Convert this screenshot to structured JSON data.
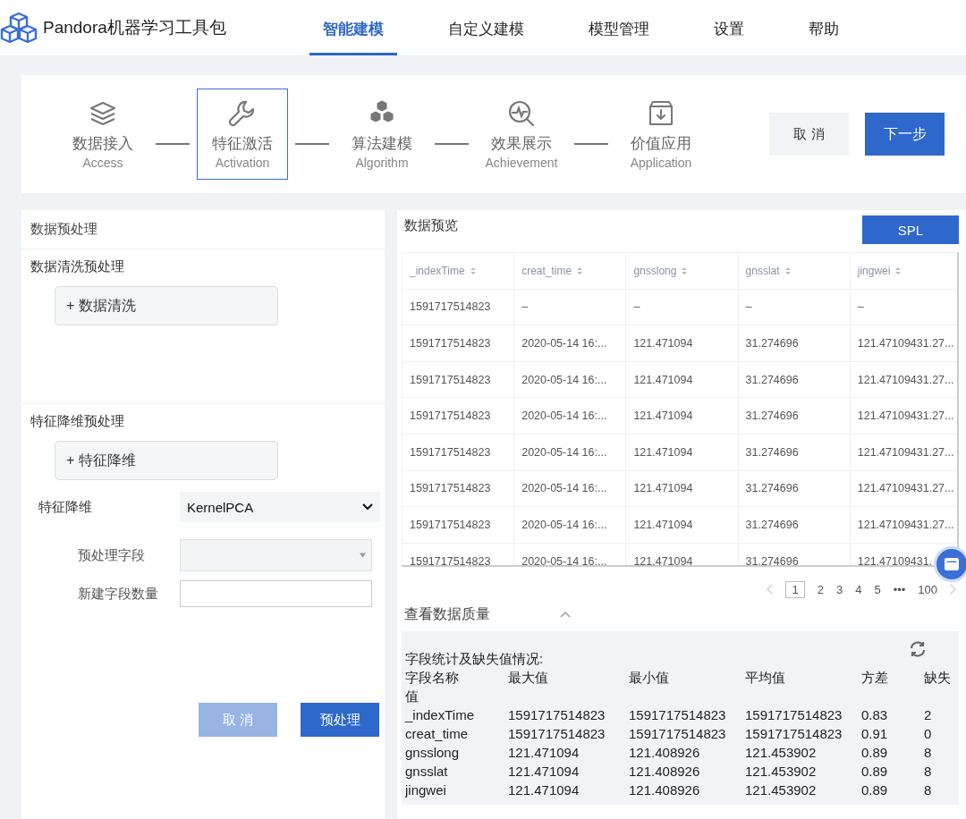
{
  "app": {
    "title": "Pandora机器学习工具包"
  },
  "nav": [
    {
      "label": "智能建模",
      "selected": true
    },
    {
      "label": "自定义建模",
      "selected": false
    },
    {
      "label": "模型管理",
      "selected": false
    },
    {
      "label": "设置",
      "selected": false
    },
    {
      "label": "帮助",
      "selected": false
    }
  ],
  "steps": [
    {
      "kind": "layers",
      "label": "数据接入",
      "sublabel": "Access",
      "selected": false
    },
    {
      "kind": "wrench",
      "label": "特征激活",
      "sublabel": "Activation",
      "selected": true
    },
    {
      "kind": "cubes",
      "label": "算法建模",
      "sublabel": "Algorithm",
      "selected": false
    },
    {
      "kind": "chart",
      "label": "效果展示",
      "sublabel": "Achievement",
      "selected": false
    },
    {
      "kind": "box",
      "label": "价值应用",
      "sublabel": "Application",
      "selected": false
    }
  ],
  "step_buttons": {
    "cancel": "取 消",
    "next": "下一步"
  },
  "preprocess": {
    "title": "数据预处理",
    "cleaning": {
      "heading": "数据清洗预处理",
      "button": "+ 数据清洗"
    },
    "reduction": {
      "heading": "特征降维预处理",
      "button": "+ 特征降维"
    },
    "method": {
      "label": "特征降维",
      "value": "KernelPCA"
    },
    "field": {
      "label": "预处理字段"
    },
    "count": {
      "label": "新建字段数量"
    },
    "cancel": {
      "label": "取 消",
      "disabled": true
    },
    "submit": {
      "label": "预处理"
    }
  },
  "preview": {
    "title": "数据预览",
    "spl_button": "SPL",
    "columns": [
      "_indexTime",
      "creat_time",
      "gnsslong",
      "gnsslat",
      "jingwei"
    ],
    "rows": [
      [
        "1591717514823",
        "–",
        "–",
        "–",
        "–"
      ],
      [
        "1591717514823",
        "2020-05-14 16:...",
        "121.471094",
        "31.274696",
        "121.47109431.27..."
      ],
      [
        "1591717514823",
        "2020-05-14 16:...",
        "121.471094",
        "31.274696",
        "121.47109431.27..."
      ],
      [
        "1591717514823",
        "2020-05-14 16:...",
        "121.471094",
        "31.274696",
        "121.47109431.27..."
      ],
      [
        "1591717514823",
        "2020-05-14 16:...",
        "121.471094",
        "31.274696",
        "121.47109431.27..."
      ],
      [
        "1591717514823",
        "2020-05-14 16:...",
        "121.471094",
        "31.274696",
        "121.47109431.27..."
      ],
      [
        "1591717514823",
        "2020-05-14 16:...",
        "121.471094",
        "31.274696",
        "121.47109431.27..."
      ],
      [
        "1591717514823",
        "2020-05-14 16:...",
        "121.471094",
        "31.274696",
        "121.47109431."
      ]
    ],
    "pages": [
      {
        "label": "1",
        "selected": true
      },
      {
        "label": "2",
        "selected": false
      },
      {
        "label": "3",
        "selected": false
      },
      {
        "label": "4",
        "selected": false
      },
      {
        "label": "5",
        "selected": false
      },
      {
        "label": "•••",
        "selected": false
      },
      {
        "label": "100",
        "selected": false
      }
    ]
  },
  "quality": {
    "title": "查看数据质量",
    "expanded": true,
    "caption": "字段统计及缺失值情况:",
    "columns": [
      "字段名称",
      "最大值",
      "最小值",
      "平均值",
      "方差",
      "缺失值"
    ],
    "rows": [
      [
        "_indexTime",
        "1591717514823",
        "1591717514823",
        "1591717514823",
        "0.83",
        "2"
      ],
      [
        "creat_time",
        "1591717514823",
        "1591717514823",
        "1591717514823",
        "0.91",
        "0"
      ],
      [
        "gnsslong",
        "121.471094",
        "121.408926",
        "121.453902",
        "0.89",
        "8"
      ],
      [
        "gnsslat",
        "121.471094",
        "121.408926",
        "121.453902",
        "0.89",
        "8"
      ],
      [
        "jingwei",
        "121.471094",
        "121.408926",
        "121.453902",
        "0.89",
        "8"
      ]
    ]
  }
}
